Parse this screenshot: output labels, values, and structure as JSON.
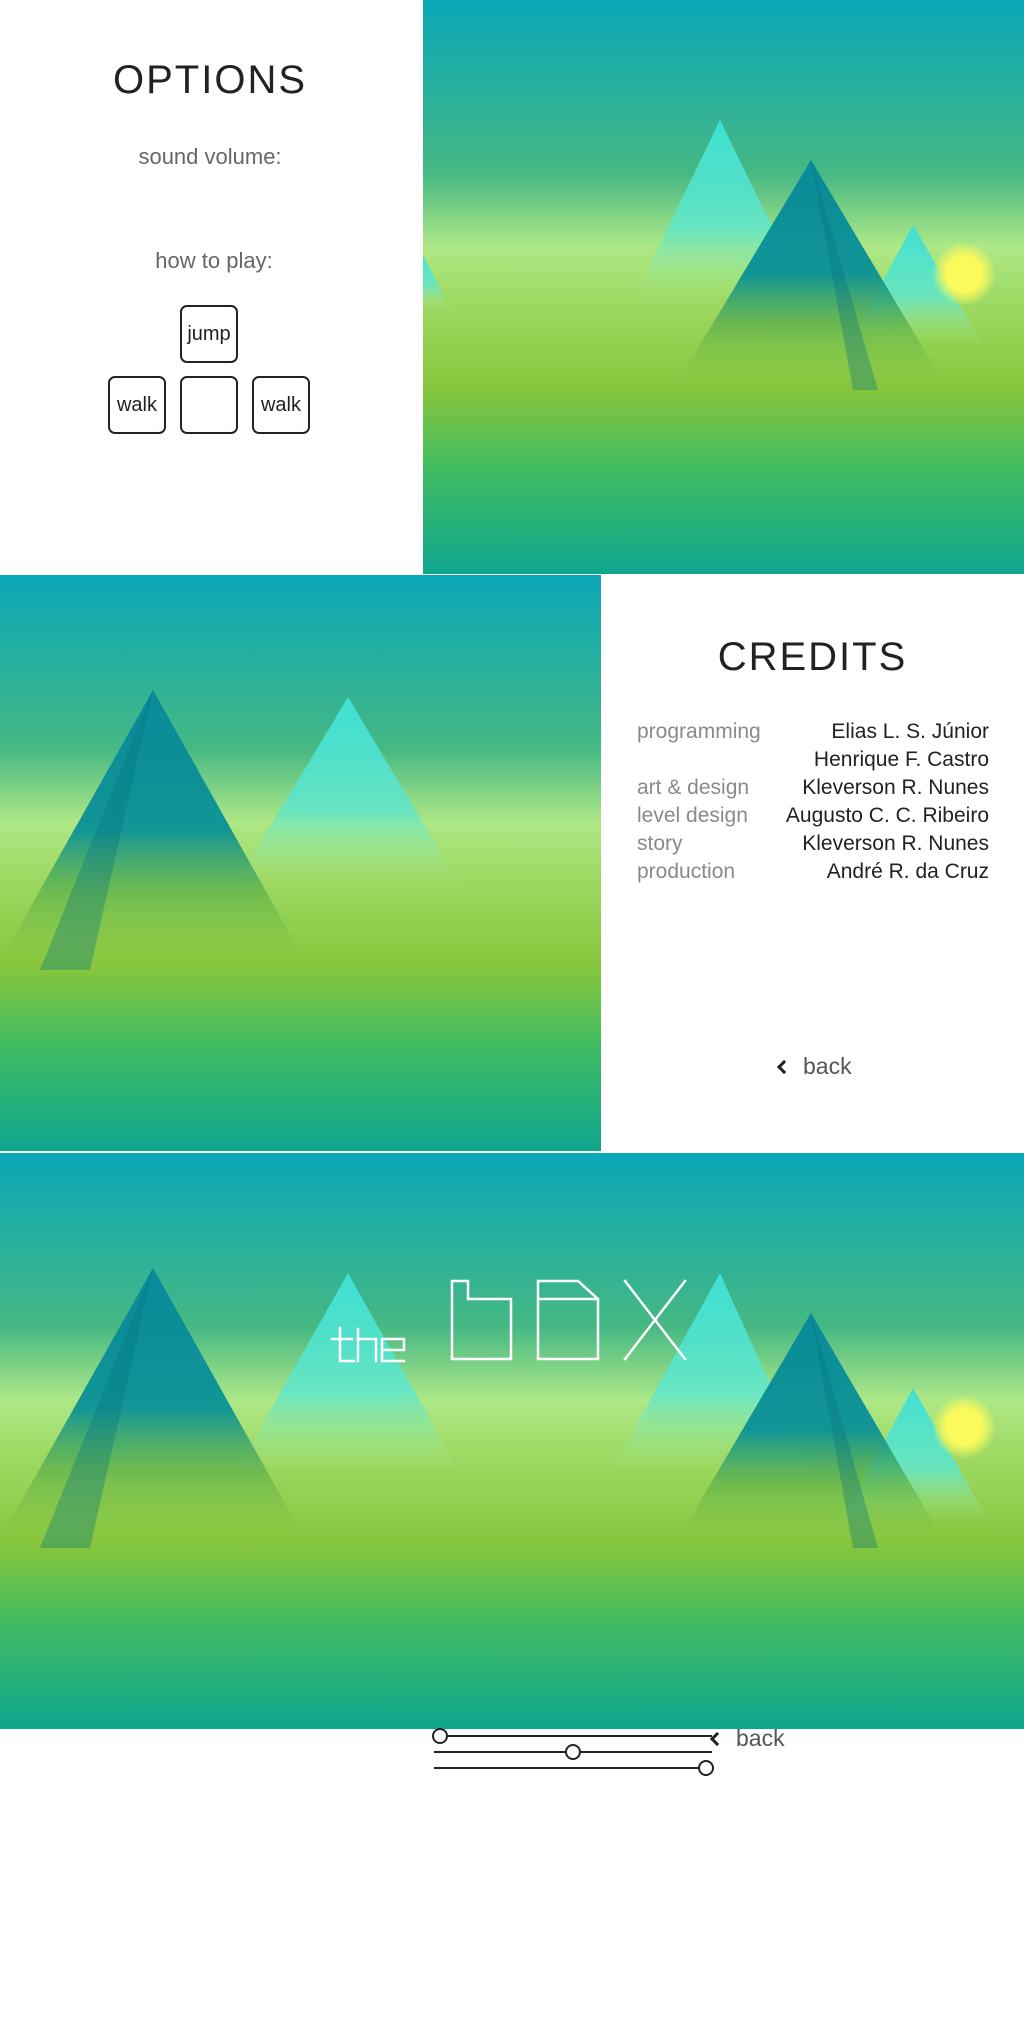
{
  "options": {
    "title": "OPTIONS",
    "sound_volume_label": "sound volume:",
    "how_to_play_label": "how to play:",
    "keys": {
      "up": "jump",
      "left": "walk",
      "down": "",
      "right": "walk"
    }
  },
  "credits": {
    "title": "CREDITS",
    "rows": [
      {
        "role": "programming",
        "name": "Elias L. S. Júnior"
      },
      {
        "role": "",
        "name": "Henrique F. Castro"
      },
      {
        "role": "art & design",
        "name": "Kleverson R. Nunes"
      },
      {
        "role": "level design",
        "name": "Augusto C. C. Ribeiro"
      },
      {
        "role": "story",
        "name": "Kleverson R. Nunes"
      },
      {
        "role": "production",
        "name": "André R. da Cruz"
      }
    ],
    "back_label": "back"
  },
  "sprites": {
    "volume_back_label": "back",
    "sliders": [
      0.0,
      0.5,
      1.0
    ]
  },
  "colors": {
    "sky_top": "#0aa7b8",
    "sky_mid": "#4cbb7f",
    "haze": "#aee886",
    "grass": "#8cc63f",
    "ground": "#12a68c",
    "sun": "#fafa5c",
    "mountain_dark": "#0a8e96",
    "mountain_light": "#3fe0d4"
  }
}
